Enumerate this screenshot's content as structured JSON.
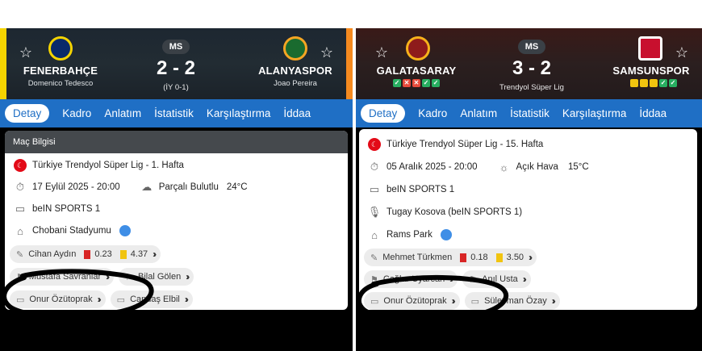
{
  "left": {
    "status": "MS",
    "home": {
      "name": "FENERBAHÇE",
      "coach": "Domenico Tedesco"
    },
    "away": {
      "name": "ALANYASPOR",
      "coach": "Joao Pereira"
    },
    "score": "2 - 2",
    "sub": "(İY 0-1)",
    "tabs": [
      "Detay",
      "Kadro",
      "Anlatım",
      "İstatistik",
      "Karşılaştırma",
      "İddaa"
    ],
    "section_title": "Maç Bilgisi",
    "league": "Türkiye Trendyol Süper Lig - 1. Hafta",
    "datetime": "17 Eylül 2025 - 20:00",
    "weather": "Parçalı Bulutlu",
    "temp": "24°C",
    "channel": "beIN SPORTS 1",
    "stadium": "Chobani Stadyumu",
    "referee": "Cihan Aydın",
    "red_stat": "0.23",
    "yellow_stat": "4.37",
    "assistant1": "Mustafa Savranlar",
    "assistant2": "Bilal Gölen",
    "var": "Onur Özütoprak",
    "avar": "Candaş Elbil",
    "colors": {
      "home_stripe": "#f5d400",
      "away_stripe": "#f58a1f"
    }
  },
  "right": {
    "status": "MS",
    "home": {
      "name": "GALATASARAY"
    },
    "away": {
      "name": "SAMSUNSPOR"
    },
    "score": "3 - 2",
    "sub": "Trendyol Süper Lig",
    "tabs": [
      "Detay",
      "Kadro",
      "Anlatım",
      "İstatistik",
      "Karşılaştırma",
      "İddaa"
    ],
    "league": "Türkiye Trendyol Süper Lig - 15. Hafta",
    "datetime": "05 Aralık 2025 - 20:00",
    "weather": "Açık Hava",
    "temp": "15°C",
    "channel": "beIN SPORTS 1",
    "commentator": "Tugay Kosova (beIN SPORTS 1)",
    "stadium": "Rams Park",
    "referee": "Mehmet Türkmen",
    "red_stat": "0.18",
    "yellow_stat": "3.50",
    "assistant1": "Çağlar Uyarcan",
    "assistant2": "Anıl Usta",
    "var": "Onur Özütoprak",
    "avar": "Süleyman Özay"
  }
}
